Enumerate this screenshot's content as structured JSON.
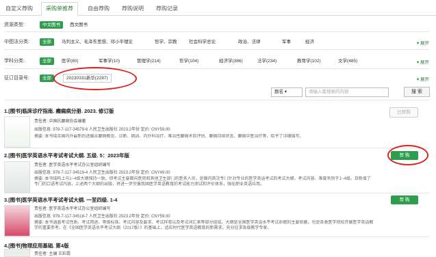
{
  "tabs": [
    "自定义荐购",
    "采购单推荐",
    "自由荐购",
    "荐购说明",
    "荐购记录"
  ],
  "filters": {
    "resource_type": {
      "label": "资源类型:",
      "options": [
        "中文图书",
        "西文图书"
      ]
    },
    "clc": {
      "label": "中图法分类:",
      "options": [
        "全部",
        "马列主义、毛泽东思想、邓小平理论",
        "哲学、宗教",
        "社会科学总论",
        "政治、法律",
        "军事",
        "经济"
      ],
      "more": "展开"
    },
    "discipline": {
      "label": "学科分类:",
      "options": [
        "全部",
        "医学(80)",
        "军事学(10)",
        "管理学(214)",
        "哲学(104)",
        "经济学(386)",
        "法学(234)",
        "教育学(102)",
        "文学(485)"
      ],
      "more": "展开"
    },
    "order_no": {
      "label": "征订目录号:",
      "options": [
        "全部",
        "20230331新华(2287)"
      ],
      "more": "展开"
    }
  },
  "search": {
    "field": "题名",
    "placeholder": "请输入需搜索的内容",
    "button": "搜 索"
  },
  "items": [
    {
      "title": "1.[图书]临床诊疗指南. 癫痫病分册. 2023. 修订版",
      "author": "责任者: 中国抗癫痫协会编著",
      "pub": "出版信息: 978-7-117-34579-6 人民卫生出版社 2023.2年份   定价: CNY59.00",
      "abstract": "摘要: 本书结合国内外最新的进展从癫痫概念、诊断、病因、内外科治疗、难治性癫痫术前评估、癫痫持续状态、癫痫中医治疗等，给予了详细描写。",
      "button": "已荐购"
    },
    {
      "title": "2.[图书]医学英语水平考试考试大纲. 五级. 5：2023年版",
      "author": "责任者: 医学英语水平考试办公室组织编写",
      "pub": "出版信息: 978-7-117-34519-4 人民卫生出版社 2023.2年份   定价: CNY49.00",
      "abstract": "摘要: 本书结构上与1~4级大纲保持一致。但考试主要面向医院和其他卫生部门的医务人员，是国内首次专门针对专业的医学英语考试的考试大纲，考试内容、难度有别于1~4级。且新增了专门的口语考试内容，上述两个大纲的出版，将进一步完善我国医学英语教育的考试能力测试和评价体系，强化职业英语应用。",
      "button": "荐 购"
    },
    {
      "title": "3.[图书]医学英语水平考试考试大纲. 一至四级. 1-4",
      "author": "责任者: 医学英语水平考试办公室组织编写",
      "pub": "出版信息: 978-7-117-34518-7 人民卫生出版社 2023.2年份   定价: CNY59.00",
      "abstract": "摘要: 本书涵盖考试性质、考试用途、等级标准、考试内容及要求、考试样卷以及考试词汇表等部分组成。大纲是全国医学英语水平考试命题的主要依据，也是各类医学院校开展医学英语教学的重要参考。在《全国医学英语水平考试大纲（2017版）》的基础上，适应时代医学英语教育的新需求，充分征求各级教学专家。",
      "button": "荐 购"
    },
    {
      "title": "4.[图书]物理应用基础. 第4版",
      "author": "责任者: 主编 王彩霞",
      "button": ""
    }
  ]
}
